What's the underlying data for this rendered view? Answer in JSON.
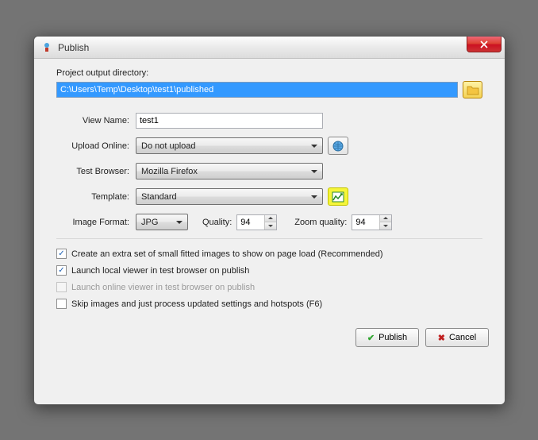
{
  "window": {
    "title": "Publish"
  },
  "labels": {
    "project_output_directory": "Project output directory:",
    "view_name": "View Name:",
    "upload_online": "Upload Online:",
    "test_browser": "Test Browser:",
    "template": "Template:",
    "image_format": "Image Format:",
    "quality": "Quality:",
    "zoom_quality": "Zoom quality:"
  },
  "fields": {
    "output_path": "C:\\Users\\Temp\\Desktop\\test1\\published",
    "view_name": "test1",
    "upload_online": "Do not upload",
    "test_browser": "Mozilla Firefox",
    "template": "Standard",
    "image_format": "JPG",
    "quality": "94",
    "zoom_quality": "94"
  },
  "checks": {
    "extra_small_images": "Create an extra set of small fitted images to show on page load (Recommended)",
    "launch_local_viewer": "Launch local viewer in test browser on publish",
    "launch_online_viewer": "Launch online viewer in test browser on publish",
    "skip_images": "Skip images and just process updated settings and hotspots (F6)"
  },
  "buttons": {
    "publish": "Publish",
    "cancel": "Cancel"
  }
}
